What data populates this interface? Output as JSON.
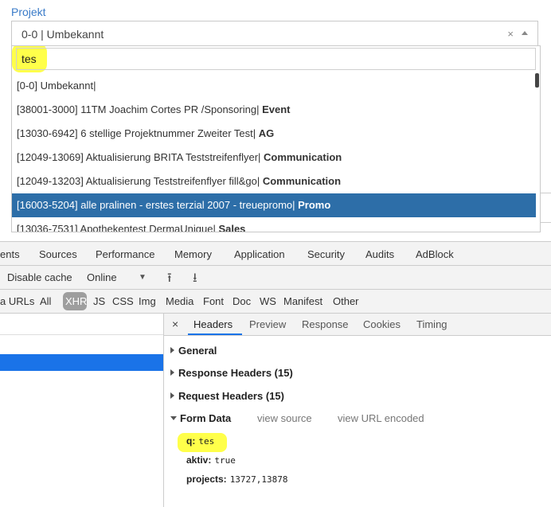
{
  "form": {
    "label": "Projekt",
    "selected_value": "0-0 | Umbekannt",
    "clear_symbol": "×",
    "search_value": "tes",
    "options": [
      {
        "text": "[0-0] Umbekannt|",
        "category": ""
      },
      {
        "text": "[38001-3000] 11TM Joachim Cortes PR /Sponsoring| ",
        "category": "Event"
      },
      {
        "text": "[13030-6942] 6 stellige Projektnummer Zweiter Test| ",
        "category": "AG"
      },
      {
        "text": "[12049-13069] Aktualisierung BRITA Teststreifenflyer| ",
        "category": "Communication"
      },
      {
        "text": "[12049-13203] Aktualisierung Teststreifenflyer fill&go| ",
        "category": "Communication"
      },
      {
        "text": "[16003-5204] alle pralinen - erstes terzial 2007 - treuepromo| ",
        "category": "Promo",
        "selected": true
      },
      {
        "text": "[13036-7531] Apothekentest DermaUnique| ",
        "category": "Sales"
      }
    ]
  },
  "devtools": {
    "tabs": [
      "ents",
      "Sources",
      "Performance",
      "Memory",
      "Application",
      "Security",
      "Audits",
      "AdBlock"
    ],
    "toolbar": {
      "disable_cache": "Disable cache",
      "throttle": "Online",
      "dropdown_symbol": "▼",
      "upload_symbol": "⭱",
      "download_symbol": "⭳"
    },
    "filters": [
      "a URLs",
      "All",
      "XHR",
      "JS",
      "CSS",
      "Img",
      "Media",
      "Font",
      "Doc",
      "WS",
      "Manifest",
      "Other"
    ],
    "detail_close": "×",
    "detail_tabs": [
      "Headers",
      "Preview",
      "Response",
      "Cookies",
      "Timing"
    ],
    "sections": {
      "general": "General",
      "response_headers": "Response Headers (15)",
      "request_headers": "Request Headers (15)",
      "form_data": "Form Data",
      "view_source": "view source",
      "view_url_encoded": "view URL encoded"
    },
    "form_data": [
      {
        "key": "q:",
        "value": "tes"
      },
      {
        "key": "aktiv:",
        "value": "true"
      },
      {
        "key": "projects:",
        "value": "13727,13878"
      }
    ]
  }
}
